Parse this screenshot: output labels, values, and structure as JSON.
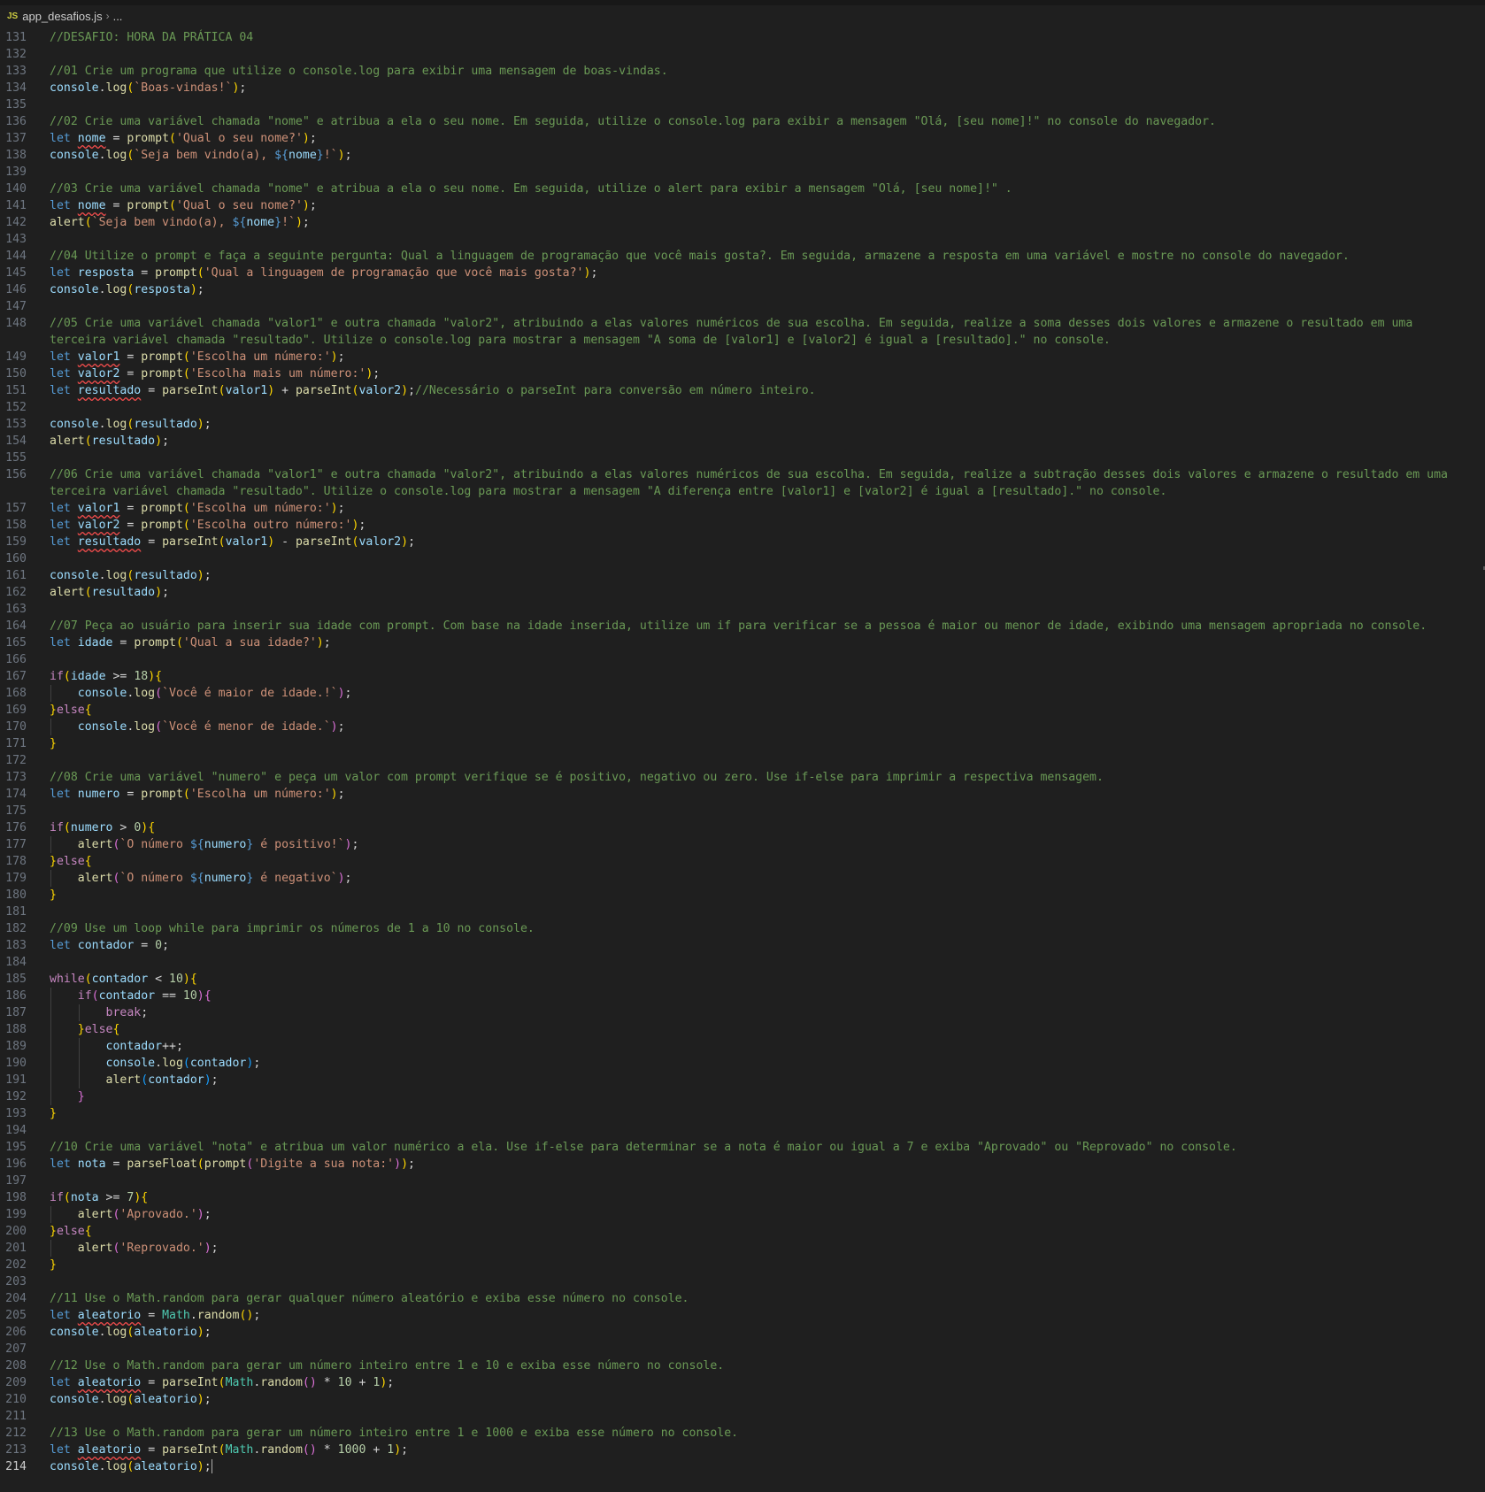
{
  "breadcrumb": {
    "file_icon": "JS",
    "file_name": "app_desafios.js",
    "separator_icon": "chevron-right-icon",
    "rest": "..."
  },
  "editor": {
    "current_line": 214,
    "first_line": 131
  },
  "colors": {
    "background": "#1f1f1f",
    "comment": "#6a9955",
    "keyword": "#569cd6",
    "string": "#ce9178",
    "function": "#dcdcaa",
    "variable": "#9cdcfe"
  },
  "lines": [
    {
      "n": "131",
      "text": "//DESAFIO: HORA DA PRÁTICA 04"
    },
    {
      "n": "132",
      "text": ""
    },
    {
      "n": "133",
      "text": "//01 Crie um programa que utilize o console.log para exibir uma mensagem de boas-vindas."
    },
    {
      "n": "134",
      "text": "console.log(`Boas-vindas!`);"
    },
    {
      "n": "135",
      "text": ""
    },
    {
      "n": "136",
      "text": "//02 Crie uma variável chamada \"nome\" e atribua a ela o seu nome. Em seguida, utilize o console.log para exibir a mensagem \"Olá, [seu nome]!\" no console do navegador."
    },
    {
      "n": "137",
      "text": "let nome = prompt('Qual o seu nome?');"
    },
    {
      "n": "138",
      "text": "console.log(`Seja bem vindo(a), ${nome}!`);"
    },
    {
      "n": "139",
      "text": ""
    },
    {
      "n": "140",
      "text": "//03 Crie uma variável chamada \"nome\" e atribua a ela o seu nome. Em seguida, utilize o alert para exibir a mensagem \"Olá, [seu nome]!\" ."
    },
    {
      "n": "141",
      "text": "let nome = prompt('Qual o seu nome?');"
    },
    {
      "n": "142",
      "text": "alert(`Seja bem vindo(a), ${nome}!`);"
    },
    {
      "n": "143",
      "text": ""
    },
    {
      "n": "144",
      "text": "//04 Utilize o prompt e faça a seguinte pergunta: Qual a linguagem de programação que você mais gosta?. Em seguida, armazene a resposta em uma variável e mostre no console do navegador."
    },
    {
      "n": "145",
      "text": "let resposta = prompt('Qual a linguagem de programação que você mais gosta?');"
    },
    {
      "n": "146",
      "text": "console.log(resposta);"
    },
    {
      "n": "147",
      "text": ""
    },
    {
      "n": "148",
      "text": "//05 Crie uma variável chamada \"valor1\" e outra chamada \"valor2\", atribuindo a elas valores numéricos de sua escolha. Em seguida, realize a soma desses dois valores e armazene o resultado em uma terceira variável chamada \"resultado\". Utilize o console.log para mostrar a mensagem \"A soma de [valor1] e [valor2] é igual a [resultado].\" no console."
    },
    {
      "n": "149",
      "text": "let valor1 = prompt('Escolha um número:');"
    },
    {
      "n": "150",
      "text": "let valor2 = prompt('Escolha mais um número:');"
    },
    {
      "n": "151",
      "text": "let resultado = parseInt(valor1) + parseInt(valor2);//Necessário o parseInt para conversão em número inteiro."
    },
    {
      "n": "152",
      "text": ""
    },
    {
      "n": "153",
      "text": "console.log(resultado);"
    },
    {
      "n": "154",
      "text": "alert(resultado);"
    },
    {
      "n": "155",
      "text": ""
    },
    {
      "n": "156",
      "text": "//06 Crie uma variável chamada \"valor1\" e outra chamada \"valor2\", atribuindo a elas valores numéricos de sua escolha. Em seguida, realize a subtração desses dois valores e armazene o resultado em uma terceira variável chamada \"resultado\". Utilize o console.log para mostrar a mensagem \"A diferença entre [valor1] e [valor2] é igual a [resultado].\" no console."
    },
    {
      "n": "157",
      "text": "let valor1 = prompt('Escolha um número:');"
    },
    {
      "n": "158",
      "text": "let valor2 = prompt('Escolha outro número:');"
    },
    {
      "n": "159",
      "text": "let resultado = parseInt(valor1) - parseInt(valor2);"
    },
    {
      "n": "160",
      "text": ""
    },
    {
      "n": "161",
      "text": "console.log(resultado);"
    },
    {
      "n": "162",
      "text": "alert(resultado);"
    },
    {
      "n": "163",
      "text": ""
    },
    {
      "n": "164",
      "text": "//07 Peça ao usuário para inserir sua idade com prompt. Com base na idade inserida, utilize um if para verificar se a pessoa é maior ou menor de idade, exibindo uma mensagem apropriada no console."
    },
    {
      "n": "165",
      "text": "let idade = prompt('Qual a sua idade?');"
    },
    {
      "n": "166",
      "text": ""
    },
    {
      "n": "167",
      "text": "if(idade >= 18){"
    },
    {
      "n": "168",
      "text": "    console.log(`Você é maior de idade.!`);"
    },
    {
      "n": "169",
      "text": "}else{"
    },
    {
      "n": "170",
      "text": "    console.log(`Você é menor de idade.`);"
    },
    {
      "n": "171",
      "text": "}"
    },
    {
      "n": "172",
      "text": ""
    },
    {
      "n": "173",
      "text": "//08 Crie uma variável \"numero\" e peça um valor com prompt verifique se é positivo, negativo ou zero. Use if-else para imprimir a respectiva mensagem."
    },
    {
      "n": "174",
      "text": "let numero = prompt('Escolha um número:');"
    },
    {
      "n": "175",
      "text": ""
    },
    {
      "n": "176",
      "text": "if(numero > 0){"
    },
    {
      "n": "177",
      "text": "    alert(`O número ${numero} é positivo!`);"
    },
    {
      "n": "178",
      "text": "}else{"
    },
    {
      "n": "179",
      "text": "    alert(`O número ${numero} é negativo`);"
    },
    {
      "n": "180",
      "text": "}"
    },
    {
      "n": "181",
      "text": ""
    },
    {
      "n": "182",
      "text": "//09 Use um loop while para imprimir os números de 1 a 10 no console."
    },
    {
      "n": "183",
      "text": "let contador = 0;"
    },
    {
      "n": "184",
      "text": ""
    },
    {
      "n": "185",
      "text": "while(contador < 10){"
    },
    {
      "n": "186",
      "text": "    if(contador == 10){"
    },
    {
      "n": "187",
      "text": "        break;"
    },
    {
      "n": "188",
      "text": "    }else{"
    },
    {
      "n": "189",
      "text": "        contador++;"
    },
    {
      "n": "190",
      "text": "        console.log(contador);"
    },
    {
      "n": "191",
      "text": "        alert(contador);"
    },
    {
      "n": "192",
      "text": "    }"
    },
    {
      "n": "193",
      "text": "}"
    },
    {
      "n": "194",
      "text": ""
    },
    {
      "n": "195",
      "text": "//10 Crie uma variável \"nota\" e atribua um valor numérico a ela. Use if-else para determinar se a nota é maior ou igual a 7 e exiba \"Aprovado\" ou \"Reprovado\" no console."
    },
    {
      "n": "196",
      "text": "let nota = parseFloat(prompt('Digite a sua nota:'));"
    },
    {
      "n": "197",
      "text": ""
    },
    {
      "n": "198",
      "text": "if(nota >= 7){"
    },
    {
      "n": "199",
      "text": "    alert('Aprovado.');"
    },
    {
      "n": "200",
      "text": "}else{"
    },
    {
      "n": "201",
      "text": "    alert('Reprovado.');"
    },
    {
      "n": "202",
      "text": "}"
    },
    {
      "n": "203",
      "text": ""
    },
    {
      "n": "204",
      "text": "//11 Use o Math.random para gerar qualquer número aleatório e exiba esse número no console."
    },
    {
      "n": "205",
      "text": "let aleatorio = Math.random();"
    },
    {
      "n": "206",
      "text": "console.log(aleatorio);"
    },
    {
      "n": "207",
      "text": ""
    },
    {
      "n": "208",
      "text": "//12 Use o Math.random para gerar um número inteiro entre 1 e 10 e exiba esse número no console."
    },
    {
      "n": "209",
      "text": "let aleatorio = parseInt(Math.random() * 10 + 1);"
    },
    {
      "n": "210",
      "text": "console.log(aleatorio);"
    },
    {
      "n": "211",
      "text": ""
    },
    {
      "n": "212",
      "text": "//13 Use o Math.random para gerar um número inteiro entre 1 e 1000 e exiba esse número no console."
    },
    {
      "n": "213",
      "text": "let aleatorio = parseInt(Math.random() * 1000 + 1);"
    },
    {
      "n": "214",
      "text": "console.log(aleatorio);"
    }
  ]
}
